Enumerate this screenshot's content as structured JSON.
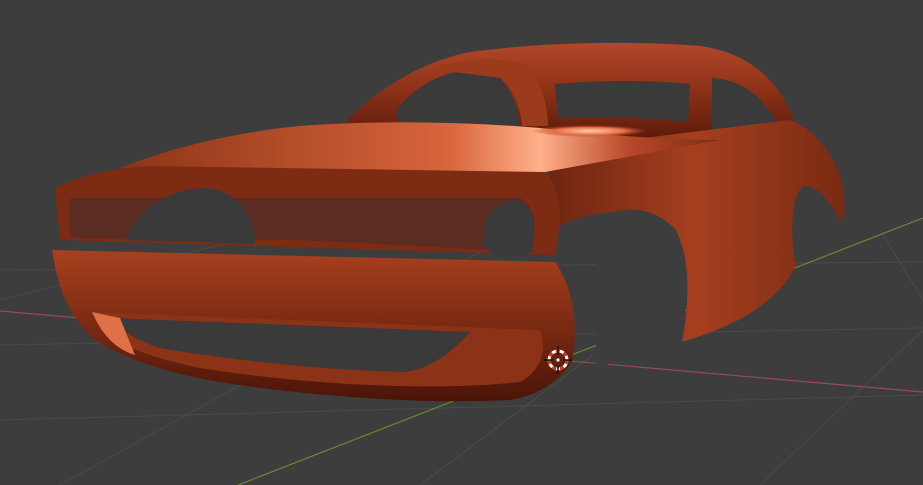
{
  "viewport": {
    "background_color": "#3d3d3d",
    "grid_line_color": "#4a4a4a",
    "x_axis_color": "#9a4a55",
    "y_axis_color": "#6b8a2e",
    "model": {
      "object": "car-body",
      "material_color": "#a8401f",
      "highlight_color": "#ff8a5a",
      "shadow_color": "#4a1408"
    },
    "cursor_3d": {
      "icon": "3d-cursor-icon",
      "ring_color_a": "#ffffff",
      "ring_color_b": "#d03020"
    }
  }
}
